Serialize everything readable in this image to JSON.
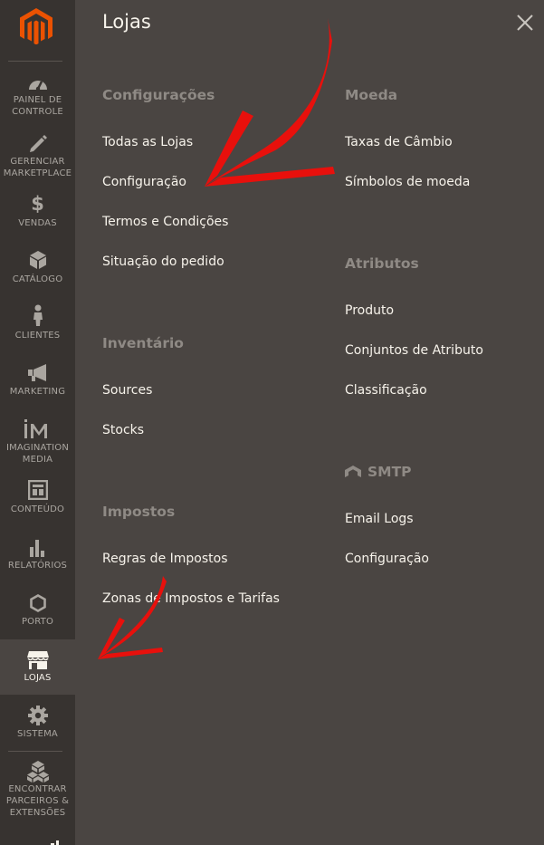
{
  "sidebar": {
    "items": [
      {
        "label": "PAINEL DE\nCONTROLE",
        "icon": "dashboard-icon"
      },
      {
        "label": "GERENCIAR\nMARKETPLACE",
        "icon": "pencil-icon"
      },
      {
        "label": "VENDAS",
        "icon": "dollar-icon"
      },
      {
        "label": "CATÁLOGO",
        "icon": "cube-icon"
      },
      {
        "label": "CLIENTES",
        "icon": "person-icon"
      },
      {
        "label": "MARKETING",
        "icon": "megaphone-icon"
      },
      {
        "label": "IMAGINATION\nMEDIA",
        "icon": "im-logo-icon"
      },
      {
        "label": "CONTEÚDO",
        "icon": "layout-icon"
      },
      {
        "label": "RELATÓRIOS",
        "icon": "bar-chart-icon"
      },
      {
        "label": "PORTO",
        "icon": "hexagon-icon"
      },
      {
        "label": "LOJAS",
        "icon": "store-icon",
        "active": true
      },
      {
        "label": "SISTEMA",
        "icon": "gear-icon"
      },
      {
        "label": "ENCONTRAR\nPARCEIROS &\nEXTENSÕES",
        "icon": "boxes-icon"
      }
    ]
  },
  "panel": {
    "title": "Lojas",
    "configuracoes": {
      "heading": "Configurações",
      "links": [
        "Todas as Lojas",
        "Configuração",
        "Termos e Condições",
        "Situação do pedido"
      ]
    },
    "inventario": {
      "heading": "Inventário",
      "links": [
        "Sources",
        "Stocks"
      ]
    },
    "impostos": {
      "heading": "Impostos",
      "links": [
        "Regras de Impostos",
        "Zonas de Impostos e Tarifas"
      ]
    },
    "moeda": {
      "heading": "Moeda",
      "links": [
        "Taxas de Câmbio",
        "Símbolos de moeda"
      ]
    },
    "atributos": {
      "heading": "Atributos",
      "links": [
        "Produto",
        "Conjuntos de Atributo",
        "Classificação"
      ]
    },
    "smtp": {
      "heading": "SMTP",
      "links": [
        "Email Logs",
        "Configuração"
      ]
    }
  },
  "colors": {
    "sidebar_bg": "#373330",
    "panel_bg": "#4a4542",
    "brand": "#eb5202",
    "annotation": "#e8100c"
  }
}
